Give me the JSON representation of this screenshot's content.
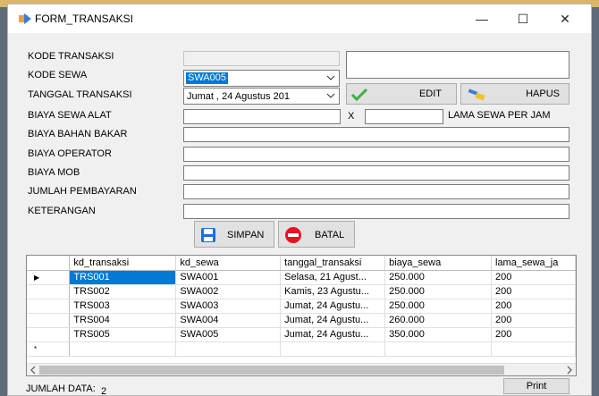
{
  "window": {
    "title": "FORM_TRANSAKSI",
    "controls": {
      "minimize": "—",
      "maximize": "☐",
      "close": "✕"
    }
  },
  "form": {
    "labels": {
      "kode_transaksi": "KODE TRANSAKSI",
      "kode_sewa": "KODE SEWA",
      "tanggal_transaksi": "TANGGAL TRANSAKSI",
      "biaya_sewa_alat": "BIAYA SEWA ALAT",
      "biaya_bahan_bakar": "BIAYA BAHAN BAKAR",
      "biaya_operator": "BIAYA OPERATOR",
      "biaya_mob": "BIAYA MOB",
      "jumlah_pembayaran": "JUMLAH PEMBAYARAN",
      "keterangan": "KETERANGAN",
      "multiply": "X",
      "lama_sewa_per_jam": "LAMA SEWA PER JAM"
    },
    "kode_sewa_value": "SWA005",
    "tanggal_value": "Jumat , 24  Agustus  201"
  },
  "buttons": {
    "edit": "EDIT",
    "hapus": "HAPUS",
    "simpan": "SIMPAN",
    "batal": "BATAL",
    "print": "Print"
  },
  "grid": {
    "columns": [
      "kd_transaksi",
      "kd_sewa",
      "tanggal_transaksi",
      "biaya_sewa",
      "lama_sewa_ja"
    ],
    "rows": [
      [
        "TRS001",
        "SWA001",
        "Selasa, 21 Agust...",
        "250.000",
        "200"
      ],
      [
        "TRS002",
        "SWA002",
        "Kamis, 23 Agustu...",
        "250.000",
        "200"
      ],
      [
        "TRS003",
        "SWA003",
        "Jumat, 24 Agustu...",
        "250.000",
        "200"
      ],
      [
        "TRS004",
        "SWA004",
        "Jumat, 24 Agustu...",
        "260.000",
        "200"
      ],
      [
        "TRS005",
        "SWA005",
        "Jumat, 24 Agustu...",
        "350.000",
        "200"
      ]
    ],
    "current_row_marker": "▶",
    "new_row_marker": "*"
  },
  "footer": {
    "jumlah_label": "JUMLAH DATA:",
    "jumlah_value": "2"
  },
  "colors": {
    "selection": "#0078d7",
    "edit_icon": "#3cb043",
    "batal_icon": "#e81123",
    "simpan_icon": "#1e6fd9"
  },
  "icons": {
    "edit": "checkmark-icon",
    "hapus": "broom-icon",
    "simpan": "floppy-icon",
    "batal": "minus-circle-icon"
  }
}
